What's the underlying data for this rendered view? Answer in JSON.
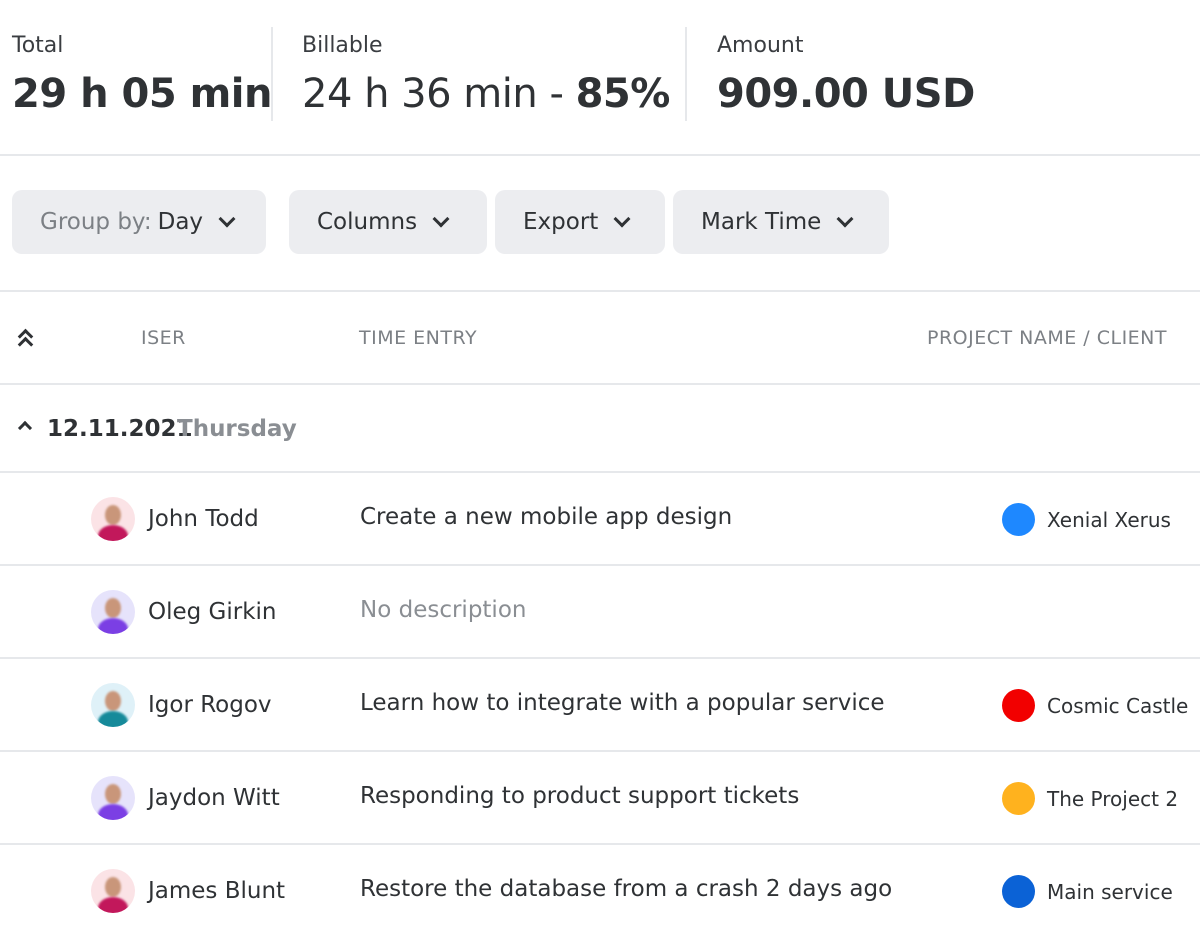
{
  "summary": {
    "total": {
      "label": "Total",
      "value": "29 h 05 min"
    },
    "billable": {
      "label": "Billable",
      "value": "24 h 36 min - ",
      "percent": "85%"
    },
    "amount": {
      "label": "Amount",
      "value": "909.00 USD"
    }
  },
  "toolbar": {
    "group_by": {
      "label": "Group by:",
      "value": "Day"
    },
    "columns": "Columns",
    "export": "Export",
    "mark_time": "Mark Time"
  },
  "table": {
    "columns": {
      "user": "ISER",
      "time_entry": "TIME ENTRY",
      "project": "PROJECT NAME / CLIENT"
    },
    "group": {
      "date": "12.11.2021",
      "day": "Thursday"
    },
    "rows": [
      {
        "user": "John Todd",
        "entry": "Create a new mobile app design",
        "project": "Xenial Xerus",
        "project_color": "#1e88ff",
        "avatar_bg": "#fbe3e6",
        "avatar_body": "#c2185b"
      },
      {
        "user": "Oleg Girkin",
        "entry": "No description",
        "project": "",
        "project_color": "",
        "avatar_bg": "#e6e3fb",
        "avatar_body": "#7b3fe4"
      },
      {
        "user": "Igor Rogov",
        "entry": "Learn how to integrate with a popular service",
        "project": "Cosmic Castle",
        "project_color": "#f20000",
        "avatar_bg": "#dff1f8",
        "avatar_body": "#168a9a"
      },
      {
        "user": "Jaydon Witt",
        "entry": "Responding to product support tickets",
        "project": "The Project 2",
        "project_color": "#ffb21e",
        "avatar_bg": "#e6e3fb",
        "avatar_body": "#7b3fe4"
      },
      {
        "user": "James Blunt",
        "entry": "Restore the database from a crash 2 days ago",
        "project": "Main service",
        "project_color": "#0b62d6",
        "avatar_bg": "#fbe3e6",
        "avatar_body": "#c2185b"
      }
    ]
  }
}
